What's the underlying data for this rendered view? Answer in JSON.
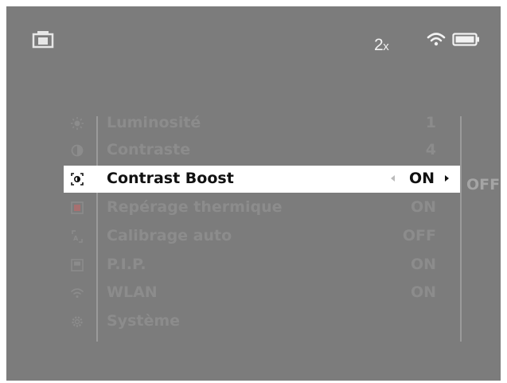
{
  "status_bar": {
    "camera_icon": "camera-icon",
    "zoom_value": "2",
    "zoom_suffix": "x",
    "wifi_icon": "wifi-icon",
    "battery_icon": "battery-icon"
  },
  "menu": {
    "items": [
      {
        "icon": "brightness-icon",
        "label": "Luminosité",
        "value": "1"
      },
      {
        "icon": "contrast-icon",
        "label": "Contraste",
        "value": "4"
      },
      {
        "icon": "contrast-boost-icon",
        "label": "Contrast Boost",
        "value": "ON",
        "selected": true
      },
      {
        "icon": "hot-tracking-icon",
        "label": "Repérage thermique",
        "value": "ON"
      },
      {
        "icon": "auto-calibration-icon",
        "label": "Calibrage auto",
        "value": "OFF"
      },
      {
        "icon": "pip-icon",
        "label": "P.I.P.",
        "value": "ON"
      },
      {
        "icon": "wlan-icon",
        "label": "WLAN",
        "value": "ON"
      },
      {
        "icon": "system-gear-icon",
        "label": "Système",
        "value": ""
      }
    ],
    "submenu_alternative": "OFF"
  },
  "colors": {
    "screen_bg": "#7c7c7c",
    "selected_bg": "#ffffff",
    "dim_text": "#8c8c8c"
  }
}
